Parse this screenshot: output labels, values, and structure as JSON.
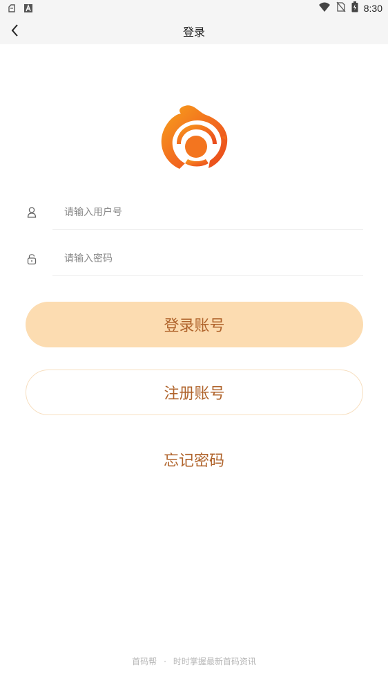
{
  "status_bar": {
    "time": "8:30",
    "icons": [
      "notification-icon",
      "a-icon",
      "wifi-icon",
      "no-sim-icon",
      "battery-icon"
    ]
  },
  "nav": {
    "title": "登录",
    "back_icon": "chevron-left-icon"
  },
  "logo": {
    "colors": [
      "#f05a1e",
      "#f7a21c"
    ]
  },
  "form": {
    "username": {
      "placeholder": "请输入用户号",
      "value": "",
      "icon": "user-icon"
    },
    "password": {
      "placeholder": "请输入密码",
      "value": "",
      "icon": "lock-icon"
    }
  },
  "buttons": {
    "login_label": "登录账号",
    "register_label": "注册账号",
    "forgot_label": "忘记密码"
  },
  "footer": {
    "brand": "首码帮",
    "separator": "·",
    "slogan": "时时掌握最新首码资讯"
  },
  "colors": {
    "accent_text": "#b0642c",
    "login_bg": "#fcdcb1",
    "register_border": "#f7dfc0"
  }
}
